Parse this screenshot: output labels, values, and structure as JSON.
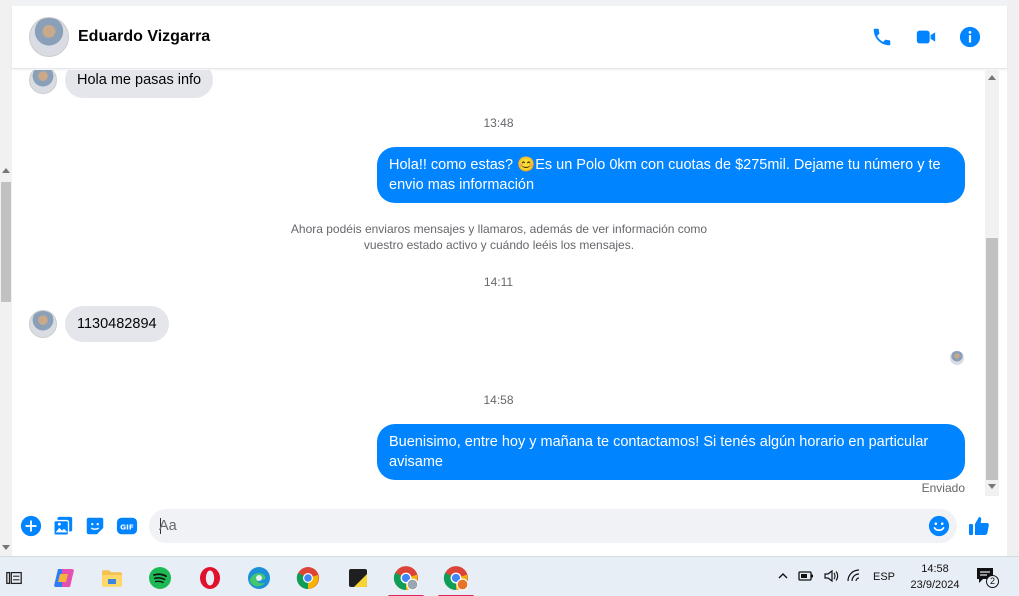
{
  "header": {
    "contact_name": "Eduardo Vizgarra"
  },
  "messages": {
    "m1": "Hola me pasas info",
    "t1": "13:48",
    "m2": "Hola!! como estas? 😊Es un Polo 0km con cuotas de $275mil. Dejame tu número y te envio mas información",
    "notice": "Ahora podéis enviaros mensajes y llamaros, además de ver información como vuestro estado activo y cuándo leéis los mensajes.",
    "t2": "14:11",
    "m3": "1130482894",
    "t3": "14:58",
    "m4": "Buenisimo, entre hoy y mañana te contactamos! Si tenés algún horario en particular avisame",
    "status": "Enviado"
  },
  "composer": {
    "placeholder": "Aa"
  },
  "taskbar": {
    "language": "ESP",
    "time": "14:58",
    "date": "23/9/2024",
    "notification_count": "2"
  },
  "colors": {
    "accent": "#0084ff",
    "incoming_bubble": "#e4e6eb"
  }
}
